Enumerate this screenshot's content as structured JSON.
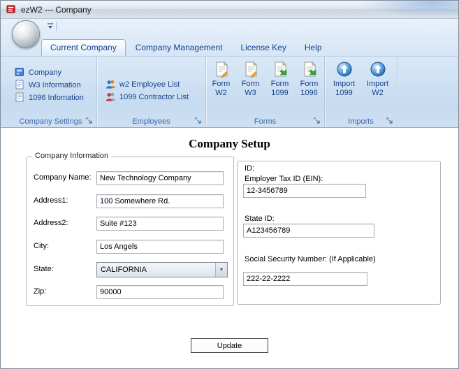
{
  "window": {
    "title": "ezW2 --- Company"
  },
  "colors": {
    "accent": "#15428b",
    "ribbon_label": "#3e6aaa"
  },
  "tabs": [
    {
      "label": "Current Company",
      "active": true
    },
    {
      "label": "Company Management",
      "active": false
    },
    {
      "label": "License Key",
      "active": false
    },
    {
      "label": "Help",
      "active": false
    }
  ],
  "ribbon": {
    "company_settings": {
      "label": "Company Settings",
      "items": [
        {
          "label": "Company",
          "icon": "company-icon"
        },
        {
          "label": "W3 Information",
          "icon": "w3-form-icon"
        },
        {
          "label": "1096 Infomation",
          "icon": "form-1096-icon"
        }
      ]
    },
    "employees": {
      "label": "Employees",
      "items": [
        {
          "label": "w2 Employee List",
          "icon": "employee-people-icon"
        },
        {
          "label": "1099 Contractor List",
          "icon": "contractor-people-icon"
        }
      ]
    },
    "forms": {
      "label": "Forms",
      "items": [
        {
          "line1": "Form",
          "line2": "W2",
          "icon": "form-document-pencil-icon"
        },
        {
          "line1": "Form",
          "line2": "W3",
          "icon": "form-document-pencil-icon"
        },
        {
          "line1": "Form",
          "line2": "1099",
          "icon": "form-document-arrow-icon"
        },
        {
          "line1": "Form",
          "line2": "1096",
          "icon": "form-document-arrow-icon"
        }
      ]
    },
    "imports": {
      "label": "Imports",
      "items": [
        {
          "line1": "Import",
          "line2": "1099",
          "icon": "import-globe-icon"
        },
        {
          "line1": "Import",
          "line2": "W2",
          "icon": "import-globe-icon"
        }
      ]
    }
  },
  "main": {
    "title": "Company Setup",
    "company_info": {
      "legend": "Company Information",
      "company_name": {
        "label": "Company Name:",
        "value": "New Technology Company"
      },
      "address1": {
        "label": "Address1:",
        "value": "100 Somewhere Rd."
      },
      "address2": {
        "label": "Address2:",
        "value": "Suite #123"
      },
      "city": {
        "label": "City:",
        "value": "Los Angels"
      },
      "state": {
        "label": "State:",
        "value": "CALIFORNIA"
      },
      "zip": {
        "label": "Zip:",
        "value": "90000"
      }
    },
    "ids": {
      "heading": "ID:",
      "ein": {
        "label": "Employer Tax ID (EIN):",
        "value": "12-3456789"
      },
      "state_id": {
        "label": "State ID:",
        "value": "A123456789"
      },
      "ssn": {
        "label": "Social Security Number: (If Applicable)",
        "value": "222-22-2222"
      }
    },
    "update_label": "Update"
  }
}
